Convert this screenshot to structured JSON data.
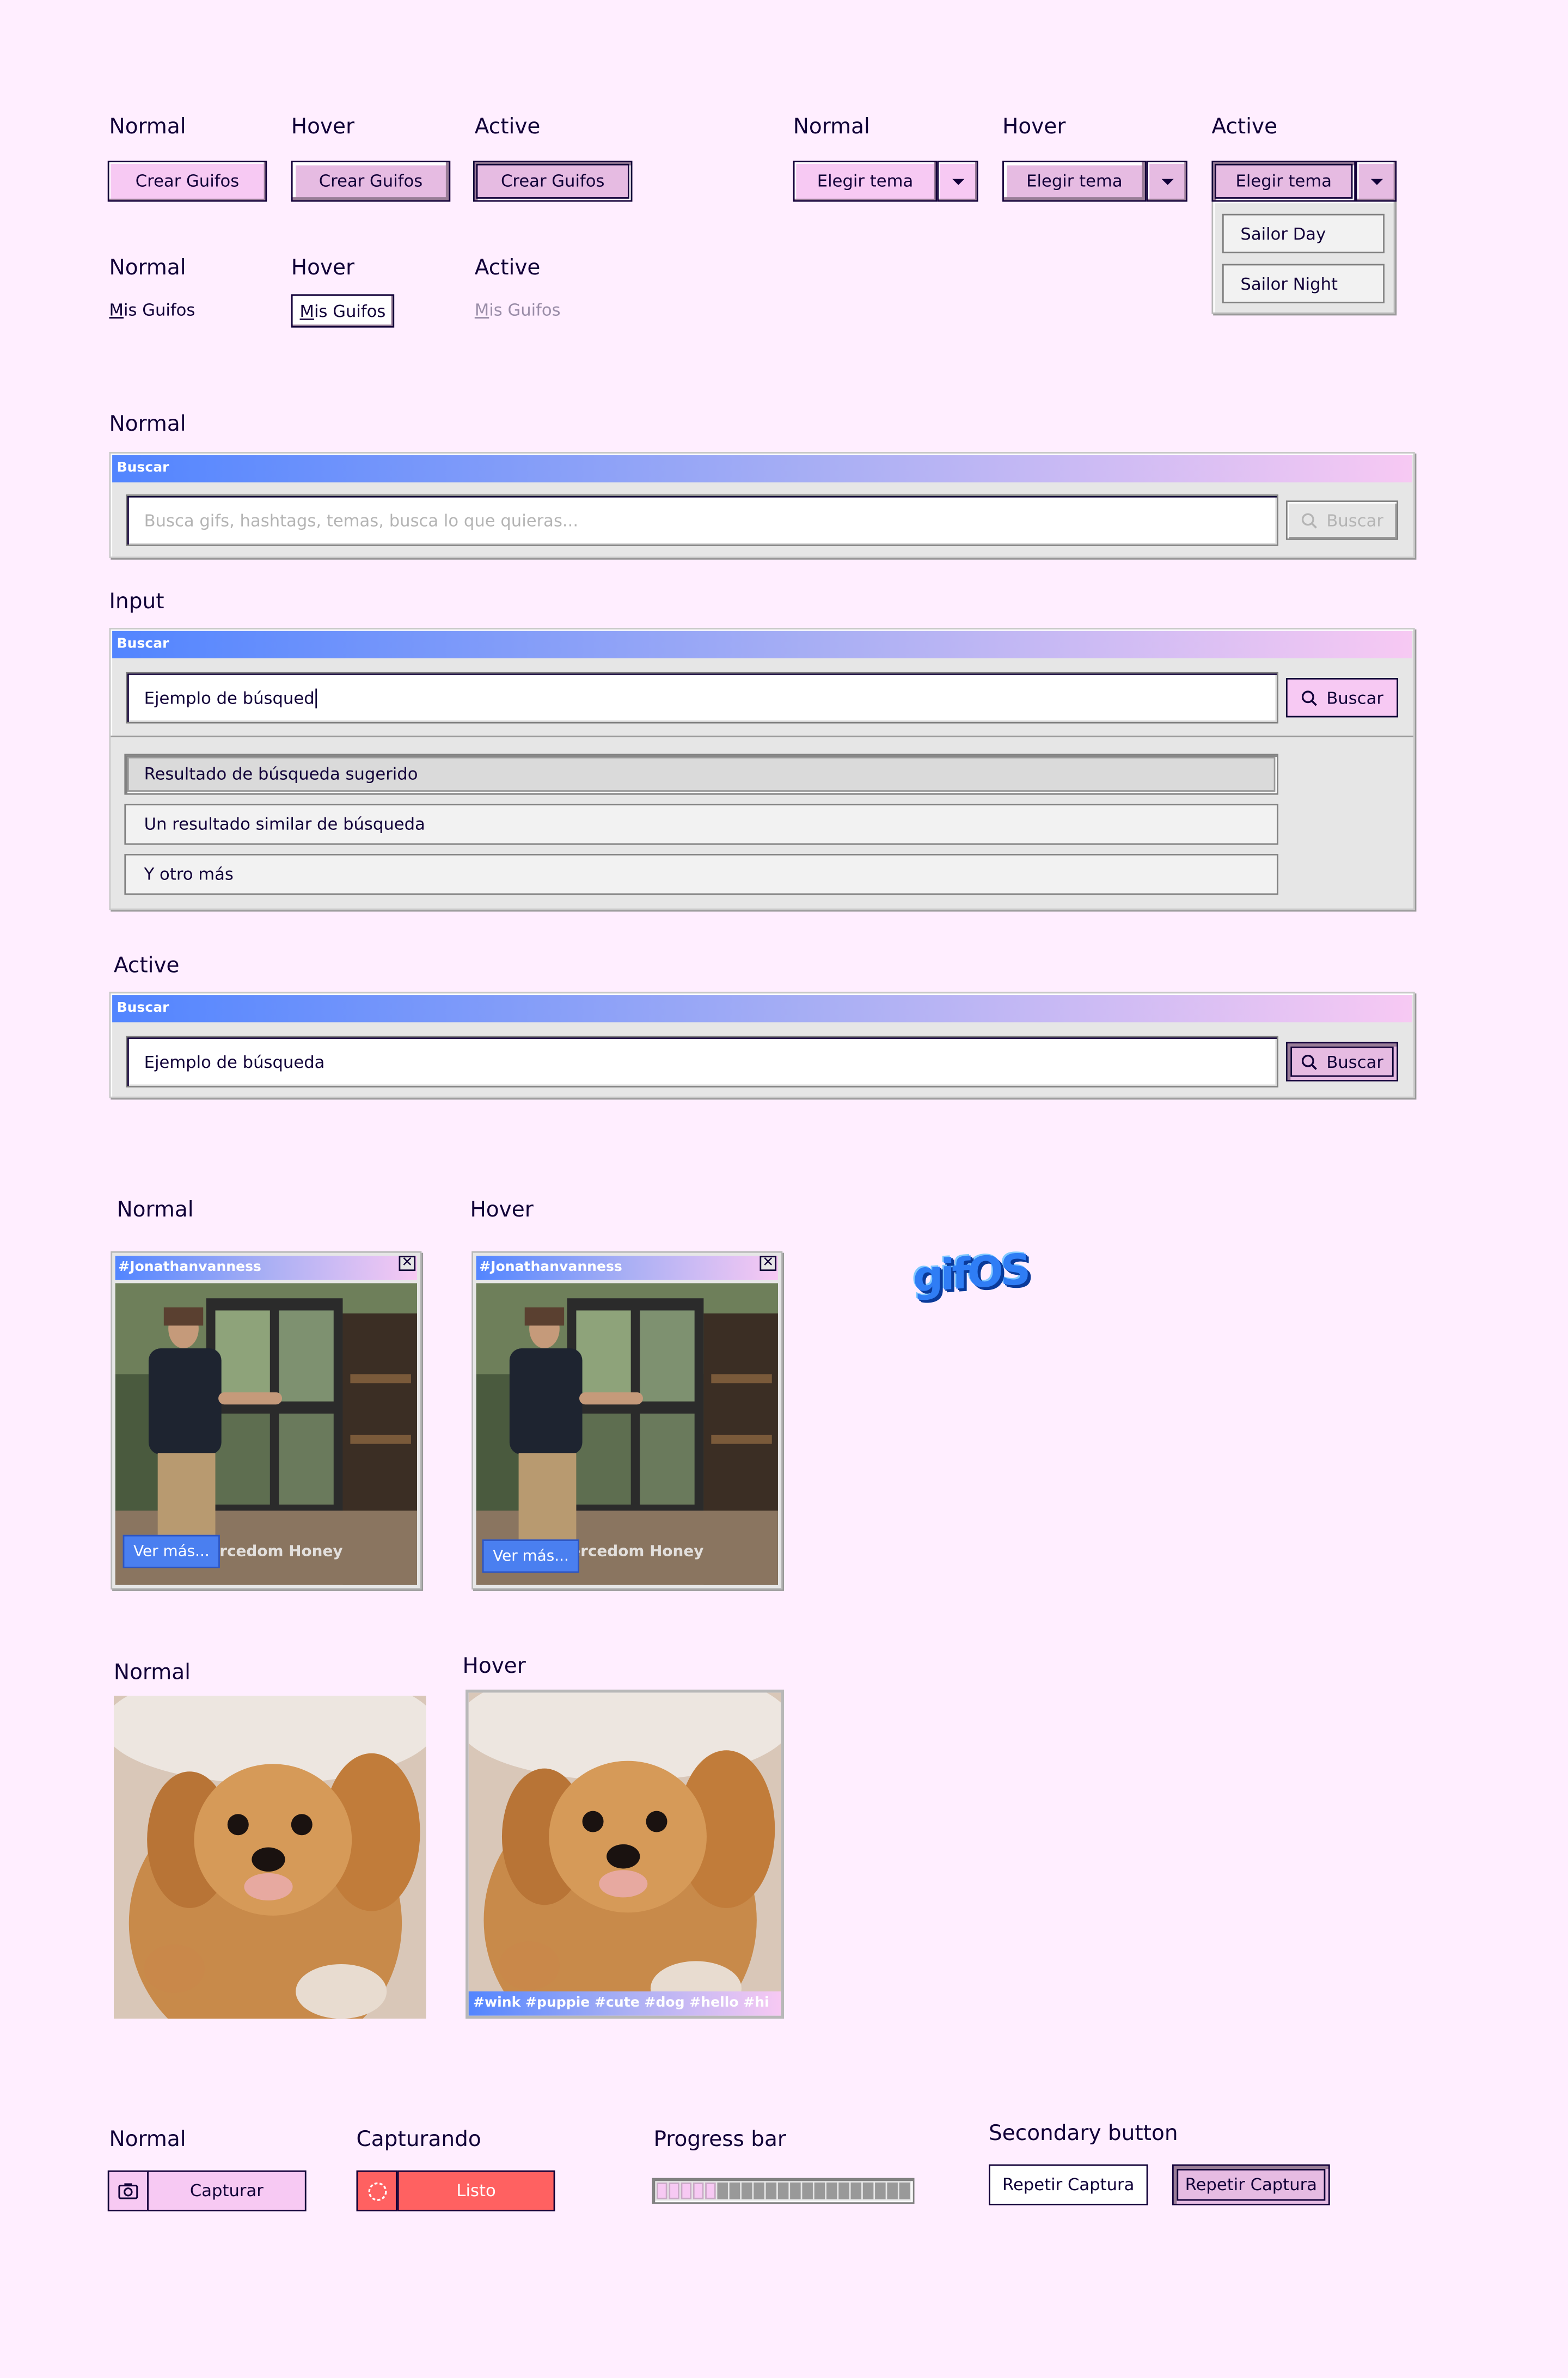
{
  "states": {
    "normal": "Normal",
    "hover": "Hover",
    "active": "Active",
    "input": "Input",
    "capturando": "Capturando",
    "progress_bar": "Progress bar",
    "secondary_button": "Secondary button"
  },
  "primary_button": {
    "label": "Crear Guifos"
  },
  "theme_dropdown": {
    "label": "Elegir tema",
    "options": [
      "Sailor Day",
      "Sailor Night"
    ]
  },
  "my_gifs_link": {
    "label": "Mis Guifos",
    "underlined_letter": "M",
    "rest": "is Guifos"
  },
  "search": {
    "window_title": "Buscar",
    "placeholder": "Busca gifs, hashtags, temas, busca lo que quieras...",
    "button_label": "Buscar",
    "typing_value": "Ejemplo de búsqued",
    "active_value": "Ejemplo de búsqueda",
    "suggestions": [
      "Resultado de búsqueda sugerido",
      "Un resultado similar de búsqueda",
      "Y otro más"
    ]
  },
  "gif_card": {
    "title": "#Jonathanvanness",
    "more_label": "Ver más...",
    "overlay_caption": "ercedom Honey"
  },
  "logo_text": "gifOS",
  "puppy_card": {
    "tags": "#wink #puppie #cute #dog #hello #hi"
  },
  "capture": {
    "capture_label": "Capturar",
    "ready_label": "Listo"
  },
  "progress": {
    "filled_fraction": 0.24
  },
  "secondary": {
    "label": "Repetir Captura"
  },
  "colors": {
    "background": "#FFEEFF",
    "primary_pink": "#F7C9F3",
    "primary_pink_pressed": "#E6BBE2",
    "text_dark": "#110038",
    "blue": "#5285FF",
    "capture_red": "#FF6161",
    "panel_gray": "#E6E6E6"
  },
  "icons": [
    "caret-down-icon",
    "close-icon",
    "search-icon",
    "camera-icon",
    "recording-icon"
  ]
}
